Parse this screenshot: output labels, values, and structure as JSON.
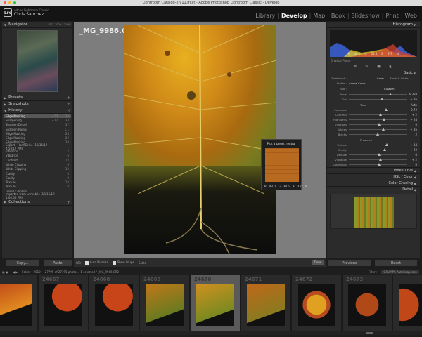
{
  "window": {
    "title": "Lightroom Catalog-2-v11.lrcat - Adobe Photoshop Lightroom Classic - Develop"
  },
  "identity": {
    "app": "Adobe Lightroom Classic",
    "user": "Chris Sanchez",
    "logo": "Lrc"
  },
  "modules": [
    "Library",
    "Develop",
    "Map",
    "Book",
    "Slideshow",
    "Print",
    "Web"
  ],
  "left": {
    "navigator": {
      "title": "Navigator",
      "zoom": [
        "FIT",
        "100%",
        "200%"
      ]
    },
    "presets": "Presets",
    "snapshots": "Snapshots",
    "history_title": "History",
    "history": [
      {
        "name": "Edge Masking",
        "v1": "+12",
        "v2": "34"
      },
      {
        "name": "Sharpening",
        "v1": "+12",
        "v2": "34"
      },
      {
        "name": "Sharpen Detail",
        "v1": "",
        "v2": "17"
      },
      {
        "name": "Sharpen Radius",
        "v1": "",
        "v2": "1.1"
      },
      {
        "name": "Edge Masking",
        "v1": "",
        "v2": "24"
      },
      {
        "name": "Edge Masking",
        "v1": "",
        "v2": "22"
      },
      {
        "name": "Edge Masking",
        "v1": "",
        "v2": "20"
      },
      {
        "name": "Export - Hard Drive (10/16/19 4:58:17 PM)",
        "v1": "",
        "v2": ""
      },
      {
        "name": "Vibrance",
        "v1": "",
        "v2": "2"
      },
      {
        "name": "Vibrance",
        "v1": "",
        "v2": "6"
      },
      {
        "name": "Contrast",
        "v1": "",
        "v2": "12"
      },
      {
        "name": "White Clipping",
        "v1": "",
        "v2": "6"
      },
      {
        "name": "White Clipping",
        "v1": "",
        "v2": "12"
      },
      {
        "name": "Clarity",
        "v1": "",
        "v2": "4"
      },
      {
        "name": "Clarity",
        "v1": "",
        "v2": "9"
      },
      {
        "name": "Texture",
        "v1": "",
        "v2": "14"
      },
      {
        "name": "Texture",
        "v1": "",
        "v2": "8"
      },
      {
        "name": "From Lr mobile",
        "v1": "",
        "v2": ""
      },
      {
        "name": "Imported from Lr mobile (10/16/19 1:00:06 PM)",
        "v1": "",
        "v2": ""
      }
    ],
    "collections": "Collections",
    "copy_button": "Copy...",
    "paste_button": "Paste"
  },
  "center": {
    "filename": "_MG_9986.CR2",
    "picker_title": "Pick a target neutral",
    "picker_vals": [
      "R",
      "43.0",
      "G",
      "30.6",
      "B",
      "8.7",
      "%"
    ],
    "toolbar": {
      "wb": "WB",
      "auto_dismiss": "Auto Dismiss",
      "show_loupe": "Show Loupe",
      "scale": "Scale",
      "done": "Done"
    }
  },
  "right": {
    "histogram": "Histogram",
    "hist_vals": [
      "R",
      "46.0",
      "G",
      "31.8",
      "B",
      "9.7",
      "%"
    ],
    "original_photo": "Original Photo",
    "basic": "Basic",
    "treatment_label": "Treatment :",
    "treatment_color": "Color",
    "treatment_bw": "Black & White",
    "profile_label": "Profile :",
    "profile_value": "Adobe Color",
    "wb_label": "WB :",
    "wb_value": "Custom",
    "sliders": [
      {
        "label": "Temp",
        "value": "6,350"
      },
      {
        "label": "Tint",
        "value": "+ 26"
      },
      {
        "label": "Tone",
        "value": "Auto"
      },
      {
        "label": "Exposure",
        "value": "+ 0.72"
      },
      {
        "label": "Contrast",
        "value": "+ 2"
      },
      {
        "label": "Highlights",
        "value": "+ 24"
      },
      {
        "label": "Shadows",
        "value": "0"
      },
      {
        "label": "Whites",
        "value": "+ 16"
      },
      {
        "label": "Blacks",
        "value": "- 2"
      },
      {
        "label": "Presence",
        "value": ""
      },
      {
        "label": "Texture",
        "value": "+ 34"
      },
      {
        "label": "Clarity",
        "value": "+ 22"
      },
      {
        "label": "Dehaze",
        "value": "0"
      },
      {
        "label": "Vibrance",
        "value": "+ 2"
      },
      {
        "label": "Saturation",
        "value": "0"
      }
    ],
    "sections": [
      "Tone Curve",
      "HSL / Color",
      "Color Grading",
      "Detail"
    ],
    "previous_button": "Previous",
    "reset_button": "Reset"
  },
  "filmstrip": {
    "folder": "Folder : 2019",
    "count": "27795 of 27795 photos / 1 selected / _MG_9986.CR2",
    "filter_label": "Filter :",
    "filter_value": "GRUMPS-AutoSequence",
    "numbers": [
      "",
      "24667",
      "24668",
      "24669",
      "24670",
      "24671",
      "24672",
      "24673",
      ""
    ]
  },
  "colors": {
    "accent": "#f2f2f2",
    "panel": "#2b2b2b",
    "selected_history": "#575757"
  }
}
